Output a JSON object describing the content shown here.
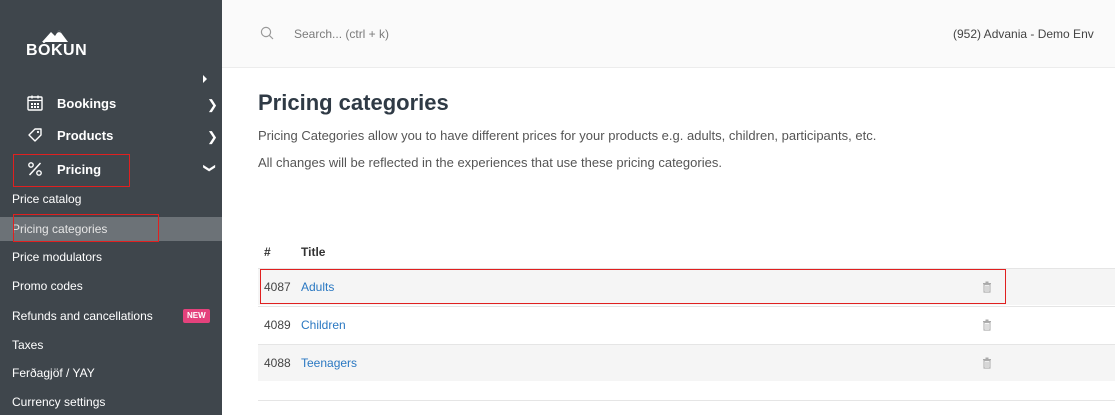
{
  "brand": {
    "name": "BÓKUN"
  },
  "header": {
    "search_placeholder": "Search... (ctrl + k)",
    "account": "(952) Advania - Demo Env"
  },
  "sidebar": {
    "main_items": [
      {
        "label": "Bookings",
        "icon": "calendar-icon"
      },
      {
        "label": "Products",
        "icon": "tag-icon"
      },
      {
        "label": "Pricing",
        "icon": "percent-icon"
      }
    ],
    "pricing_subitems": [
      {
        "label": "Price catalog"
      },
      {
        "label": "Pricing categories",
        "active": true
      },
      {
        "label": "Price modulators"
      },
      {
        "label": "Promo codes"
      },
      {
        "label": "Refunds and cancellations",
        "badge": "NEW"
      },
      {
        "label": "Taxes"
      },
      {
        "label": "Ferðagjöf / YAY"
      },
      {
        "label": "Currency settings"
      }
    ]
  },
  "main": {
    "title": "Pricing categories",
    "description_1": "Pricing Categories allow you to have different prices for your products e.g. adults, children, participants, etc.",
    "description_2": "All changes will be reflected in the experiences that use these pricing categories.",
    "table": {
      "headers": [
        "#",
        "Title"
      ],
      "rows": [
        {
          "id": "4087",
          "title": "Adults"
        },
        {
          "id": "4089",
          "title": "Children"
        },
        {
          "id": "4088",
          "title": "Teenagers"
        }
      ]
    }
  },
  "colors": {
    "sidebar_bg": "#3f464c",
    "active_item_bg": "#6c7277",
    "link": "#2a78c2",
    "badge_new": "#e4427c",
    "highlight_box": "#e02020"
  }
}
